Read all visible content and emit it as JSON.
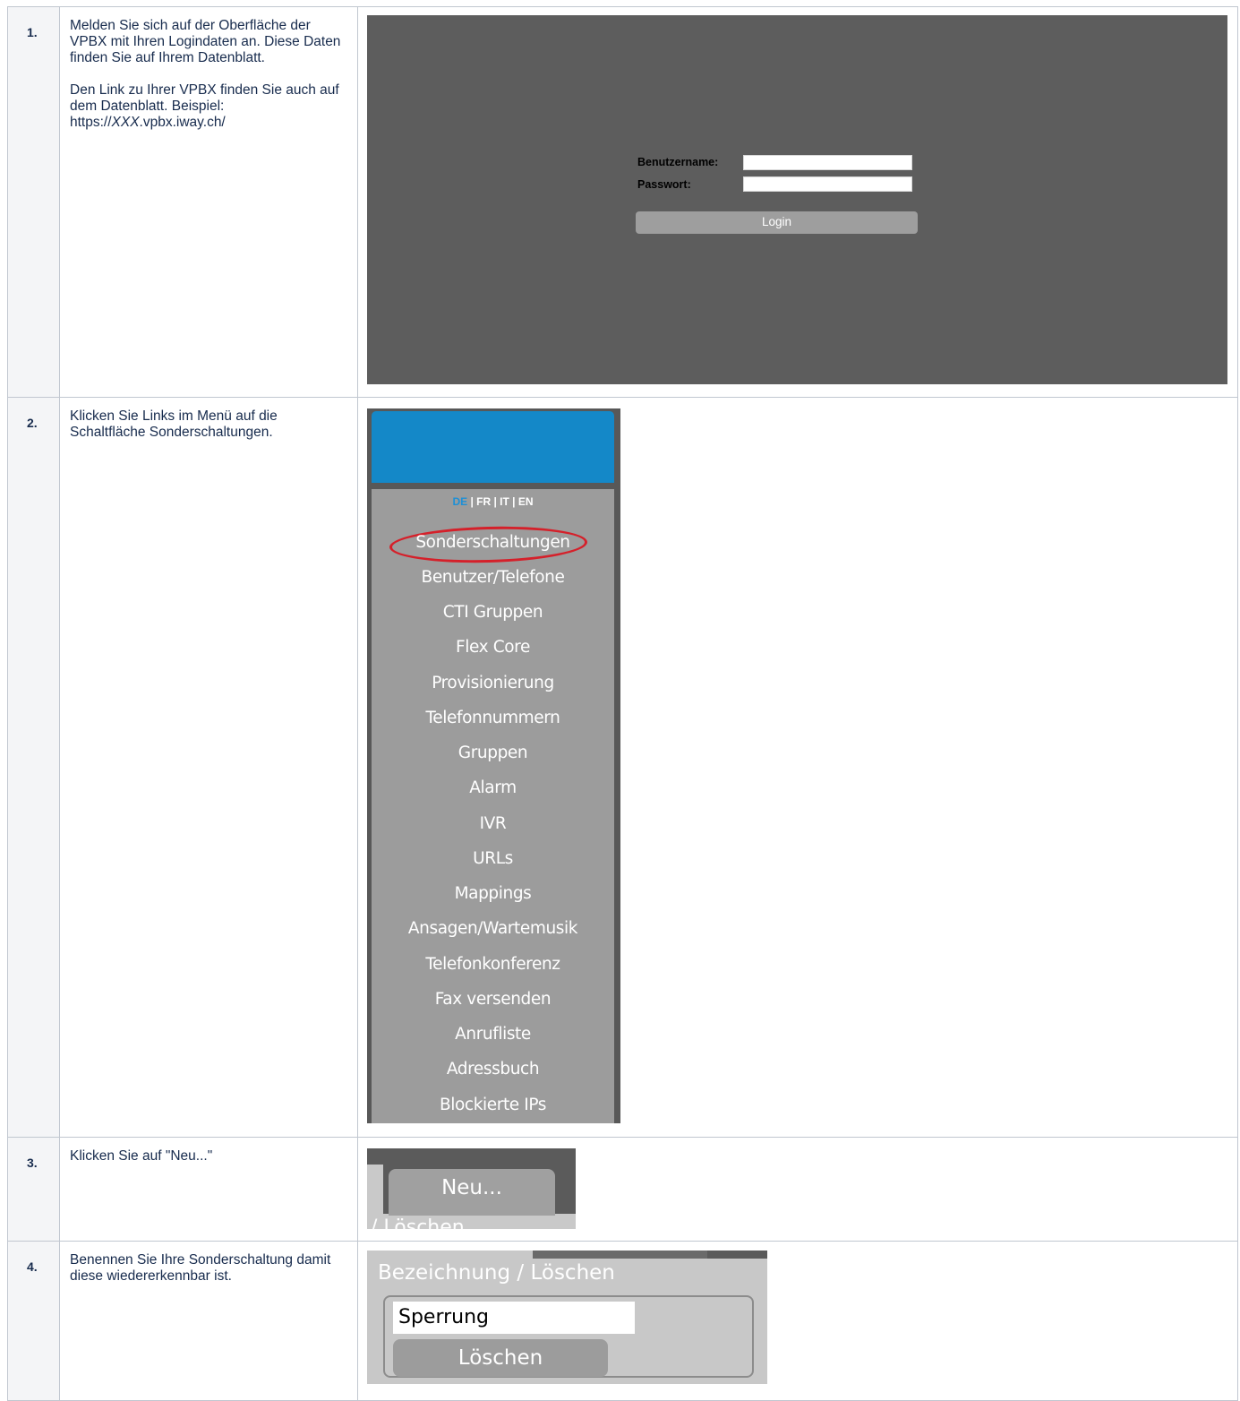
{
  "steps": [
    {
      "number": "1.",
      "text_p1": "Melden Sie sich auf der Oberfläche der VPBX mit Ihren Logindaten an. Diese Daten finden Sie auf Ihrem Datenblatt.",
      "text_p2": "Den Link zu Ihrer VPBX finden Sie auch auf dem Datenblatt. Beispiel:",
      "link_prefix": "https://",
      "link_italic": "XXX",
      "link_suffix": ".vpbx.iway.ch/"
    },
    {
      "number": "2.",
      "text_p1": "Klicken Sie Links im Menü auf die Schaltfläche Sonderschaltungen."
    },
    {
      "number": "3.",
      "text_p1": "Klicken Sie auf \"Neu...\""
    },
    {
      "number": "4.",
      "text_p1": "Benennen Sie Ihre Sonderschaltung damit diese wiedererkennbar ist."
    }
  ],
  "login": {
    "username_label": "Benutzername:",
    "password_label": "Passwort:",
    "username_value": "",
    "password_value": "",
    "login_button": "Login",
    "background_color": "#5d5d5d"
  },
  "menu": {
    "lang_active": "DE",
    "lang_rest": " | FR | IT | EN",
    "items": [
      "Sonderschaltungen",
      "Benutzer/Telefone",
      "CTI Gruppen",
      "Flex Core",
      "Provisionierung",
      "Telefonnummern",
      "Gruppen",
      "Alarm",
      "IVR",
      "URLs",
      "Mappings",
      "Ansagen/Wartemusik",
      "Telefonkonferenz",
      "Fax versenden",
      "Anrufliste",
      "Adressbuch",
      "Blockierte IPs"
    ],
    "header_color": "#1488c8",
    "highlight_color": "#d5202a"
  },
  "neu": {
    "tab_label": "Neu...",
    "cut_text": "/ Löschen"
  },
  "bezeichnung": {
    "title": "Bezeichnung / Löschen",
    "field_value": "Sperrung",
    "delete_button": "Löschen"
  }
}
